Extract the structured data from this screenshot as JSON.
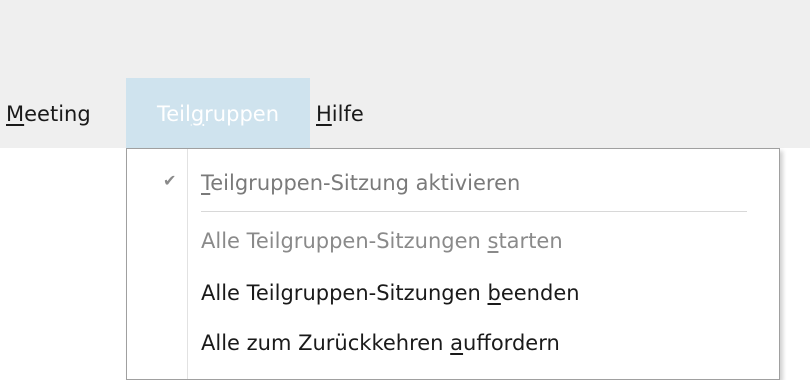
{
  "menubar": {
    "meeting": {
      "mnemonic": "M",
      "rest": "eeting"
    },
    "teilgruppen": {
      "before": "Teil",
      "mnemonic": "g",
      "rest": "ruppen"
    },
    "hilfe": {
      "mnemonic": "H",
      "rest": "ilfe"
    }
  },
  "dropdown": {
    "items": [
      {
        "before": "",
        "mnemonic": "T",
        "after": "eilgruppen-Sitzung aktivieren",
        "checked": true,
        "enabled": false
      },
      {
        "before": "Alle Teilgruppen-Sitzungen ",
        "mnemonic": "s",
        "after": "tarten",
        "enabled": false
      },
      {
        "before": "Alle Teilgruppen-Sitzungen ",
        "mnemonic": "b",
        "after": "eenden",
        "enabled": true
      },
      {
        "before": "Alle zum Zurückkehren ",
        "mnemonic": "a",
        "after": "uffordern",
        "enabled": true
      }
    ],
    "check_icon": "checkmark-icon",
    "check_glyph": "✔"
  }
}
